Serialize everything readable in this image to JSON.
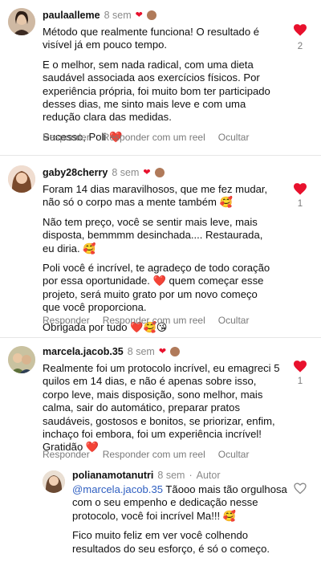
{
  "colors": {
    "heart": "#e8112d",
    "mention": "#2f5fc1",
    "muted": "#8a8a8a"
  },
  "comments": [
    {
      "username": "paulaalleme",
      "time": "8 sem",
      "paragraphs": [
        "Método que realmente funciona! O resultado é visível já em pouco tempo.",
        "E o melhor, sem nada radical, com uma dieta saudável associada aos exercícios físicos. Por experiência própria, foi muito bom ter participado desses dias, me sinto mais leve e com uma redução clara das medidas.",
        "Sucesso, Poli ❤️"
      ],
      "actions": [
        "Responder",
        "Responder com um reel",
        "Ocultar"
      ],
      "like_count": "2"
    },
    {
      "username": "gaby28cherry",
      "time": "8 sem",
      "paragraphs": [
        "Foram 14 dias maravilhosos, que me fez mudar, não só o corpo mas a mente também 🥰",
        "Não tem preço, você se sentir mais leve, mais disposta, bemmmm desinchada.... Restaurada, eu diria. 🥰",
        "Poli você é incrível, te agradeço de todo coração por essa oportunidade. ❤️ quem começar esse projeto, será muito grato por um novo começo que você proporciona.",
        "Obrigada por tudo ❤️🥰😘"
      ],
      "actions": [
        "Responder",
        "Responder com um reel",
        "Ocultar"
      ],
      "like_count": "1"
    },
    {
      "username": "marcela.jacob.35",
      "time": "8 sem",
      "paragraphs": [
        "Realmente foi um protocolo incrível, eu emagreci 5 quilos em 14 dias, e não é apenas sobre isso, corpo leve, mais disposição, sono melhor, mais calma, sair do automático, preparar pratos saudáveis, gostosos e bonitos, se priorizar, enfim, inchaço foi embora, foi um experiência incrível! Gratidão ❤️"
      ],
      "actions": [
        "Responder",
        "Responder com um reel",
        "Ocultar"
      ],
      "like_count": "1"
    }
  ],
  "reply": {
    "username": "polianamotanutri",
    "time": "8 sem",
    "author_label": "Autor",
    "mention": "@marcela.jacob.35",
    "first_text": " Tãooo mais tão orgulhosa com o seu empenho e dedicação nesse protocolo, você foi incrível Ma!!! 🥰",
    "second_text": "Fico muito feliz em ver você colhendo resultados do seu esforço, é só o começo.",
    "trailing_emojis": "🙏🏻🤍"
  }
}
